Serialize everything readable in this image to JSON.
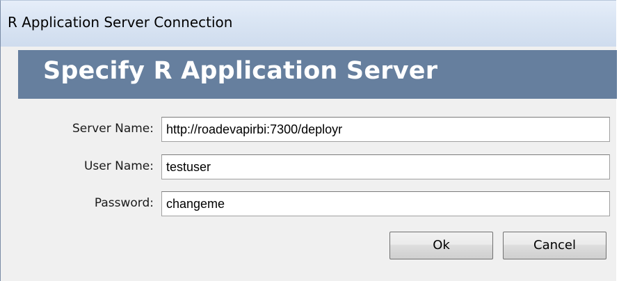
{
  "window": {
    "title": "R Application Server Connection"
  },
  "header": {
    "title": "Specify R Application Server"
  },
  "form": {
    "server_name_label": "Server Name:",
    "server_name_value": "http://roadevapirbi:7300/deployr",
    "user_name_label": "User Name:",
    "user_name_value": "testuser",
    "password_label": "Password:",
    "password_value": "changeme"
  },
  "buttons": {
    "ok_label": "Ok",
    "cancel_label": "Cancel"
  },
  "colors": {
    "header_background": "#667f9e",
    "header_text": "#ffffff",
    "dialog_background": "#f0f0f0",
    "titlebar_background": "#dbe6f4"
  }
}
